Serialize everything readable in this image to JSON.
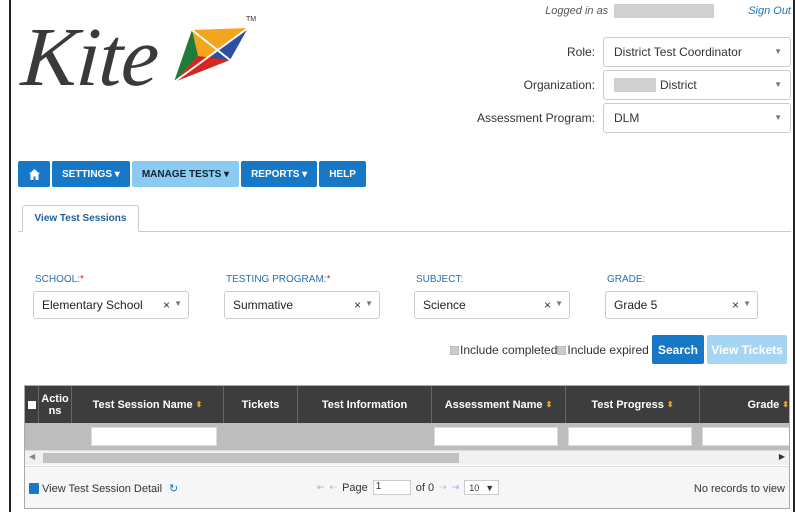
{
  "header": {
    "logo_text": "Kite",
    "logged_in_label": "Logged in as",
    "sign_out": "Sign Out",
    "role_label": "Role:",
    "role_value": "District Test Coordinator",
    "org_label": "Organization:",
    "org_value": "District",
    "program_label": "Assessment Program:",
    "program_value": "DLM"
  },
  "nav": {
    "settings": "SETTINGS ▾",
    "manage_tests": "MANAGE TESTS ▾",
    "reports": "REPORTS ▾",
    "help": "HELP"
  },
  "tabs": {
    "view_sessions": "View Test Sessions"
  },
  "filters": {
    "school_label": "SCHOOL:",
    "school_value": "Elementary School",
    "program_label": "TESTING PROGRAM:",
    "program_value": "Summative",
    "subject_label": "SUBJECT:",
    "subject_value": "Science",
    "grade_label": "GRADE:",
    "grade_value": "Grade 5"
  },
  "options": {
    "include_completed": "Include completed",
    "include_expired": "Include expired",
    "search": "Search",
    "view_tickets": "View Tickets"
  },
  "grid": {
    "columns": [
      "Actions",
      "Test Session Name",
      "Tickets",
      "Test Information",
      "Assessment Name",
      "Test Progress",
      "Grade"
    ]
  },
  "pager": {
    "detail_link": "View Test Session Detail",
    "page_label": "Page",
    "page_value": "1",
    "of_label": "of 0",
    "page_size": "10",
    "no_records": "No records to view"
  },
  "colors": {
    "primary": "#1878c8",
    "active_tab": "#8ccbf1",
    "header_bg": "#3d3d3d"
  }
}
